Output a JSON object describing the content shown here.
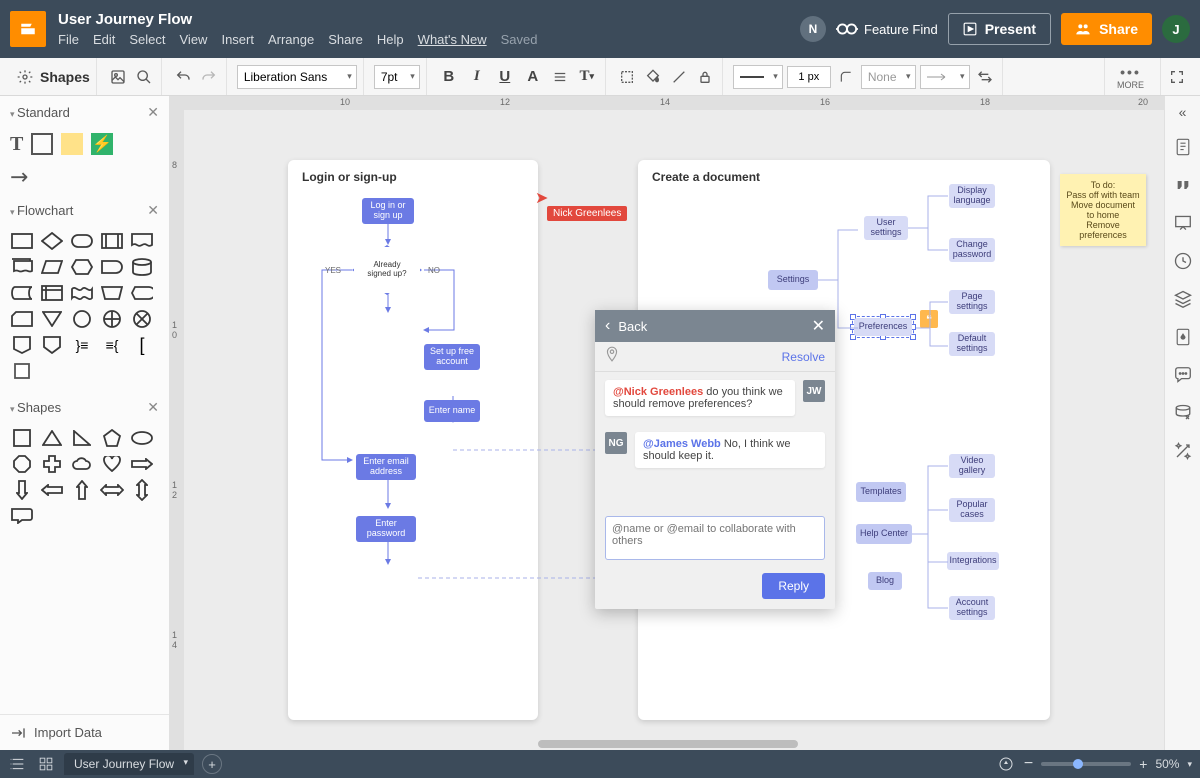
{
  "header": {
    "title": "User Journey Flow",
    "menus": [
      "File",
      "Edit",
      "Select",
      "View",
      "Insert",
      "Arrange",
      "Share",
      "Help",
      "What's New"
    ],
    "saved": "Saved",
    "notif_badge": "N",
    "feature_find": "Feature Find",
    "present": "Present",
    "share": "Share",
    "avatar": "J"
  },
  "toolbar": {
    "shapes": "Shapes",
    "font": "Liberation Sans",
    "font_size": "7pt",
    "stroke_width": "1 px",
    "fill": "None",
    "more": "MORE"
  },
  "left_panel": {
    "std": "Standard",
    "flow": "Flowchart",
    "shapes": "Shapes",
    "import": "Import Data",
    "std_text": "T"
  },
  "ruler_h": {
    "t10": "10",
    "t12": "12",
    "t14": "14",
    "t16": "16",
    "t18": "18",
    "t20": "20"
  },
  "ruler_v": {
    "t8": "8",
    "t10": "1\n0",
    "t12": "1\n2",
    "t14": "1\n4"
  },
  "canvas": {
    "page1_title": "Login or sign-up",
    "page2_title": "Create a document",
    "nodes": {
      "login": "Log in or\nsign up",
      "already": "Already\nsigned up?",
      "setup": "Set up free\naccount",
      "name": "Enter name",
      "email": "Enter email\naddress",
      "password": "Enter\npassword",
      "settings": "Settings",
      "user_settings": "User\nsettings",
      "preferences": "Preferences",
      "templates": "Templates",
      "help_center": "Help Center",
      "blog": "Blog",
      "display_lang": "Display\nlanguage",
      "change_pw": "Change\npassword",
      "page_settings": "Page\nsettings",
      "default_settings": "Default\nsettings",
      "video_gallery": "Video\ngallery",
      "popular_cases": "Popular\ncases",
      "integrations": "Integrations",
      "account_settings": "Account\nsettings"
    },
    "edge_yes": "YES",
    "edge_no": "NO",
    "cursor_user": "Nick Greenlees",
    "sticky": "To do:\nPass off with team\nMove document to home\nRemove preferences"
  },
  "comments": {
    "back": "Back",
    "resolve": "Resolve",
    "msg1_avatar": "JW",
    "msg1_mention": "@Nick Greenlees",
    "msg1_text": " do you think we should remove preferences?",
    "msg2_avatar": "NG",
    "msg2_mention": "@James Webb",
    "msg2_text": " No, I think we should keep it.",
    "placeholder": "@name or @email to collaborate with others",
    "reply": "Reply"
  },
  "bottombar": {
    "tab": "User Journey Flow",
    "zoom": "50%"
  }
}
